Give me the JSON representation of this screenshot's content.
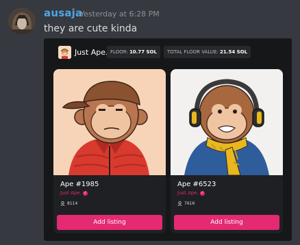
{
  "message": {
    "username": "ausaja",
    "timestamp": "Yesterday at 6:28 PM",
    "text": "they are cute kinda"
  },
  "embed": {
    "collection_name": "Just Ape.",
    "floor": {
      "label": "FLOOR:",
      "value": "10.77 SOL"
    },
    "total_floor": {
      "label": "TOTAL FLOOR VALUE:",
      "value": "21.54 SOL"
    },
    "cards": [
      {
        "title": "Ape #1985",
        "collection": "Just Ape.",
        "owner_count": "8114",
        "button_label": "Add listing"
      },
      {
        "title": "Ape #6523",
        "collection": "Just Ape.",
        "owner_count": "7616",
        "button_label": "Add listing"
      }
    ]
  },
  "colors": {
    "background": "#36393f",
    "username": "#4ea5e6",
    "embed_bg": "#161719",
    "accent": "#e32a72",
    "art1_bg": "#f7d4b8",
    "art2_bg": "#f3f1f0"
  }
}
